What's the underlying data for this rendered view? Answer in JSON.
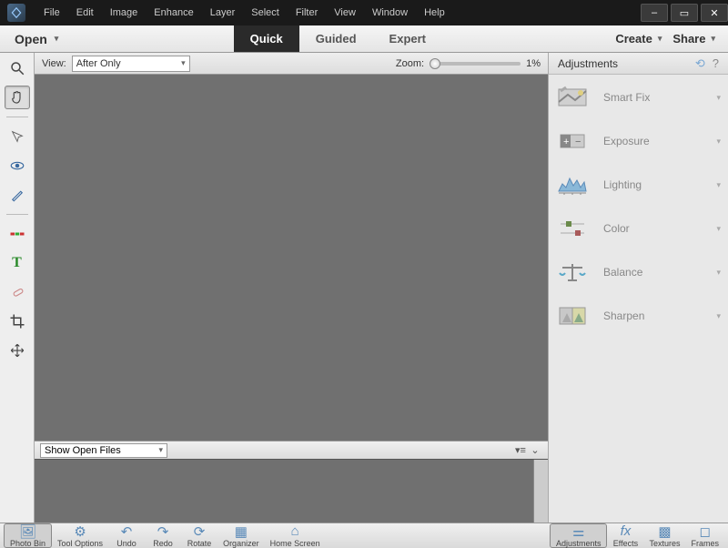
{
  "menubar": [
    "File",
    "Edit",
    "Image",
    "Enhance",
    "Layer",
    "Select",
    "Filter",
    "View",
    "Window",
    "Help"
  ],
  "topbar": {
    "open": "Open",
    "modes": [
      "Quick",
      "Guided",
      "Expert"
    ],
    "active_mode": 0,
    "create": "Create",
    "share": "Share"
  },
  "options": {
    "view_label": "View:",
    "view_value": "After Only",
    "zoom_label": "Zoom:",
    "zoom_value": "1%"
  },
  "bin": {
    "select_value": "Show Open Files"
  },
  "right_panel": {
    "title": "Adjustments",
    "items": [
      "Smart Fix",
      "Exposure",
      "Lighting",
      "Color",
      "Balance",
      "Sharpen"
    ]
  },
  "bottom": {
    "left": [
      "Photo Bin",
      "Tool Options",
      "Undo",
      "Redo",
      "Rotate",
      "Organizer",
      "Home Screen"
    ],
    "right": [
      "Adjustments",
      "Effects",
      "Textures",
      "Frames"
    ]
  }
}
